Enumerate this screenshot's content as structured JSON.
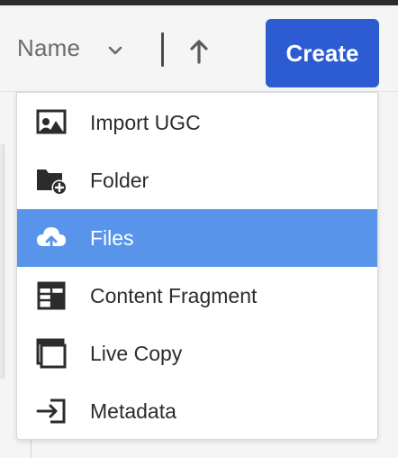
{
  "toolbar": {
    "sort_label": "Name",
    "sort_chevron_icon": "chevron-down-icon",
    "sort_direction_icon": "arrow-up-icon",
    "create_label": "Create"
  },
  "colors": {
    "accent": "#2d5bd1",
    "selected_row": "#5895ea",
    "text": "#2c2c2c",
    "muted_text": "#6b6b6b"
  },
  "menu": {
    "items": [
      {
        "label": "Import UGC",
        "icon": "image-user-icon",
        "selected": false
      },
      {
        "label": "Folder",
        "icon": "folder-add-icon",
        "selected": false
      },
      {
        "label": "Files",
        "icon": "cloud-upload-icon",
        "selected": true
      },
      {
        "label": "Content Fragment",
        "icon": "content-fragment-icon",
        "selected": false
      },
      {
        "label": "Live Copy",
        "icon": "live-copy-icon",
        "selected": false
      },
      {
        "label": "Metadata",
        "icon": "import-icon",
        "selected": false
      }
    ]
  }
}
